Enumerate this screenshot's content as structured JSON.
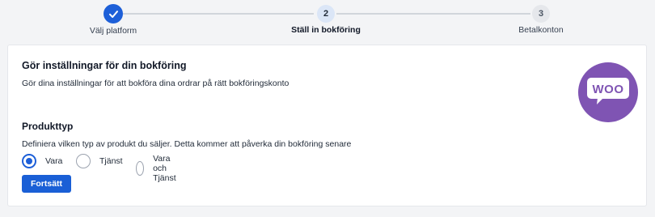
{
  "stepper": {
    "steps": [
      {
        "number": "1",
        "label": "Välj platform",
        "state": "done"
      },
      {
        "number": "2",
        "label": "Ställ in bokföring",
        "state": "active"
      },
      {
        "number": "3",
        "label": "Betalkonton",
        "state": "todo"
      }
    ],
    "done_icon": "check-icon"
  },
  "card": {
    "title": "Gör inställningar för din bokföring",
    "description": "Gör dina inställningar för att bokföra dina ordrar på rätt bokföringskonto",
    "logo_text": "WOO",
    "logo_color": "#7f54b3"
  },
  "product_type": {
    "title": "Produkttyp",
    "description": "Definiera vilken typ av produkt du säljer. Detta kommer att påverka din bokföring senare",
    "options": [
      "Vara",
      "Tjänst",
      "Vara och Tjänst"
    ],
    "selected": "Vara"
  },
  "actions": {
    "continue_label": "Fortsätt"
  },
  "colors": {
    "accent": "#1d5fd8",
    "background": "#f3f4f6"
  }
}
